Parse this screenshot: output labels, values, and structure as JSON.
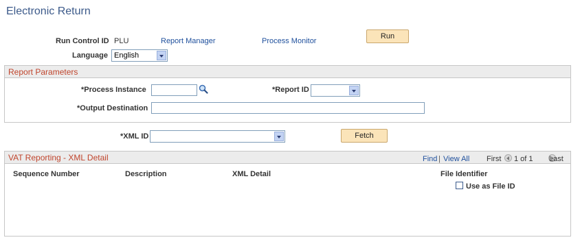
{
  "page": {
    "title": "Electronic Return"
  },
  "run_control": {
    "label": "Run Control ID",
    "value": "PLU",
    "report_manager": "Report Manager",
    "process_monitor": "Process Monitor",
    "run_button": "Run",
    "language_label": "Language",
    "language_value": "English"
  },
  "report_parameters": {
    "heading": "Report Parameters",
    "process_instance_label": "*Process Instance",
    "process_instance_value": "",
    "report_id_label": "*Report ID",
    "report_id_value": "",
    "output_destination_label": "*Output Destination",
    "output_destination_value": ""
  },
  "xml": {
    "label": "*XML ID",
    "value": "",
    "fetch_button": "Fetch"
  },
  "vat_grid": {
    "heading": "VAT Reporting - XML Detail",
    "find": "Find",
    "separator": "|",
    "view_all": "View All",
    "first": "First",
    "page_range": "1 of 1",
    "last": "Last",
    "columns": [
      "Sequence Number",
      "Description",
      "XML Detail",
      "File Identifier"
    ],
    "use_as_file_id_label": "Use as File ID",
    "use_as_file_id_checked": false
  },
  "icons": {
    "lookup": "magnifier-icon",
    "prev": "previous-arrow-icon",
    "next": "next-arrow-icon"
  }
}
